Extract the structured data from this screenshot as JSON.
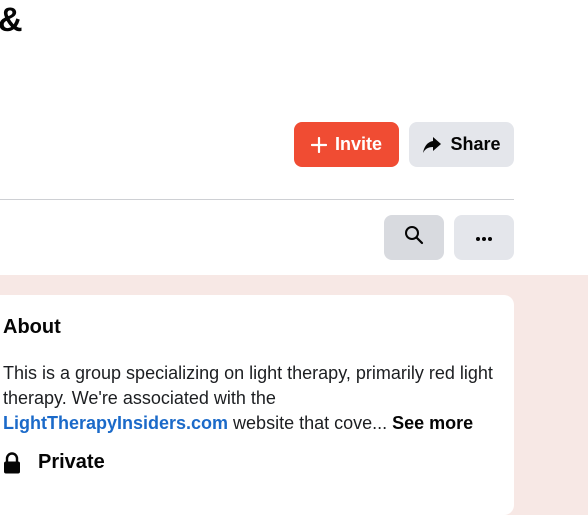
{
  "header": {
    "title_fragment": "&"
  },
  "actions": {
    "invite_label": "Invite",
    "share_label": "Share"
  },
  "toolbar": {
    "search_icon": "search-icon",
    "more_icon": "more-icon"
  },
  "about": {
    "title": "About",
    "desc_prefix": "This is a group specializing on light therapy, primarily red light therapy. We're associated with the ",
    "link_text": "LightTherapyInsiders.com",
    "desc_suffix": " website that cove... ",
    "see_more": "See more",
    "privacy_label": "Private"
  },
  "colors": {
    "accent": "#f04c33",
    "link": "#1b6ac9",
    "page_bg": "#f7e8e5",
    "button_gray": "#e4e6eb"
  }
}
